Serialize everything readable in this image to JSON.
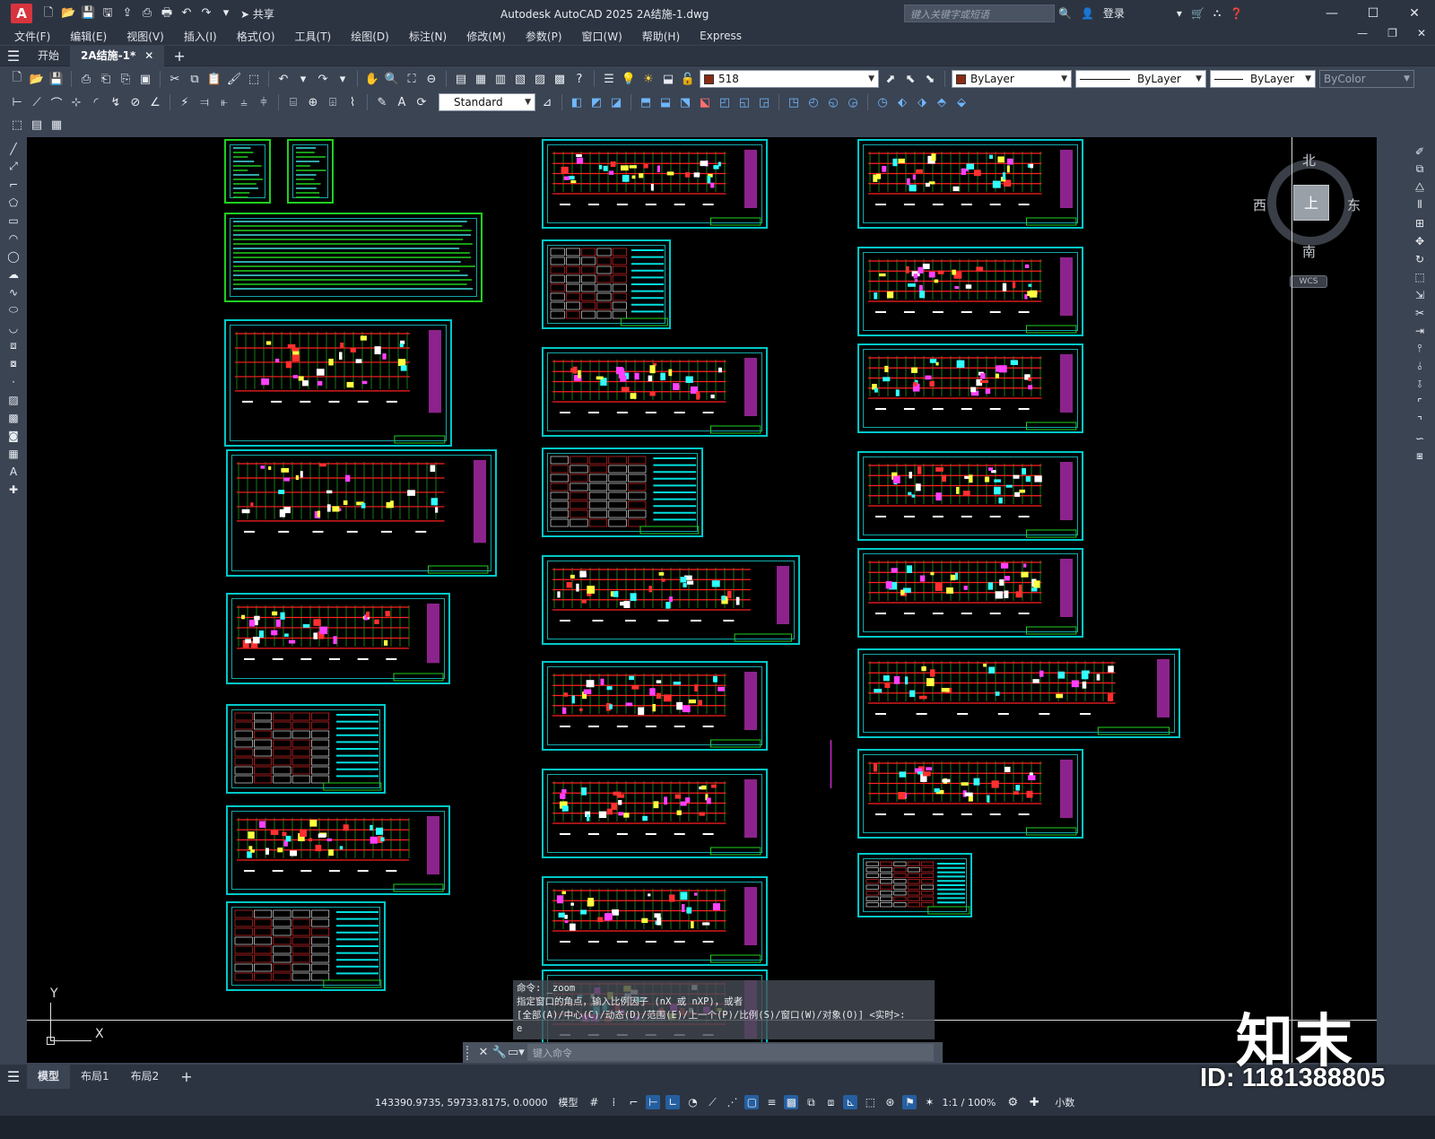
{
  "app": {
    "logo": "A",
    "title": "Autodesk AutoCAD 2025    2A结施-1.dwg",
    "share_label": "共享",
    "search_placeholder": "键入关键字或短语",
    "login_label": "登录",
    "window_controls": [
      "—",
      "☐",
      "✕"
    ]
  },
  "menu": {
    "items": [
      "文件(F)",
      "编辑(E)",
      "视图(V)",
      "插入(I)",
      "格式(O)",
      "工具(T)",
      "绘图(D)",
      "标注(N)",
      "修改(M)",
      "参数(P)",
      "窗口(W)",
      "帮助(H)",
      "Express"
    ],
    "doc_controls": [
      "—",
      "❐",
      "✕"
    ]
  },
  "tabs": {
    "start": "开始",
    "doc": "2A结施-1*",
    "add": "+"
  },
  "toolbar": {
    "layer_value": "518",
    "color_value": "ByLayer",
    "linetype_value": "ByLayer",
    "lineweight_value": "ByLayer",
    "plotstyle_value": "ByColor",
    "textstyle_value": "Standard",
    "accent_color": "#8b2a14"
  },
  "viewcube": {
    "north": "北",
    "south": "南",
    "east": "东",
    "west": "西",
    "face": "上",
    "wcs": "WCS"
  },
  "ucs": {
    "x": "X",
    "y": "Y"
  },
  "command": {
    "history": [
      "命令: _zoom",
      "指定窗口的角点，输入比例因子 (nX 或 nXP)，或者",
      "[全部(A)/中心(C)/动态(D)/范围(E)/上一个(P)/比例(S)/窗口(W)/对象(O)] <实时>:",
      "e"
    ],
    "placeholder": "键入命令"
  },
  "layout_tabs": {
    "model": "模型",
    "layout1": "布局1",
    "layout2": "布局2",
    "add": "+"
  },
  "status": {
    "coords": "143390.9735, 59733.8175, 0.0000",
    "space": "模型",
    "scale": "1:1 / 100%",
    "units": "小数"
  },
  "overlay": {
    "id_text": "ID: 1181388805",
    "logo_text": "知末"
  },
  "icons": {
    "left_tools": [
      "line-icon",
      "polyline-icon",
      "arc-icon",
      "polygon-icon",
      "rectangle-icon",
      "circle-icon",
      "spline-icon",
      "ellipse-icon",
      "block-icon",
      "point-icon",
      "hatch-icon",
      "table-icon",
      "text-icon"
    ],
    "right_tools": [
      "erase-icon",
      "copy-icon",
      "mirror-icon",
      "offset-icon",
      "array-icon",
      "move-icon",
      "rotate-icon",
      "scale-icon",
      "stretch-icon",
      "trim-icon",
      "extend-icon",
      "break-icon",
      "join-icon",
      "chamfer-icon",
      "fillet-icon",
      "explode-icon"
    ]
  }
}
